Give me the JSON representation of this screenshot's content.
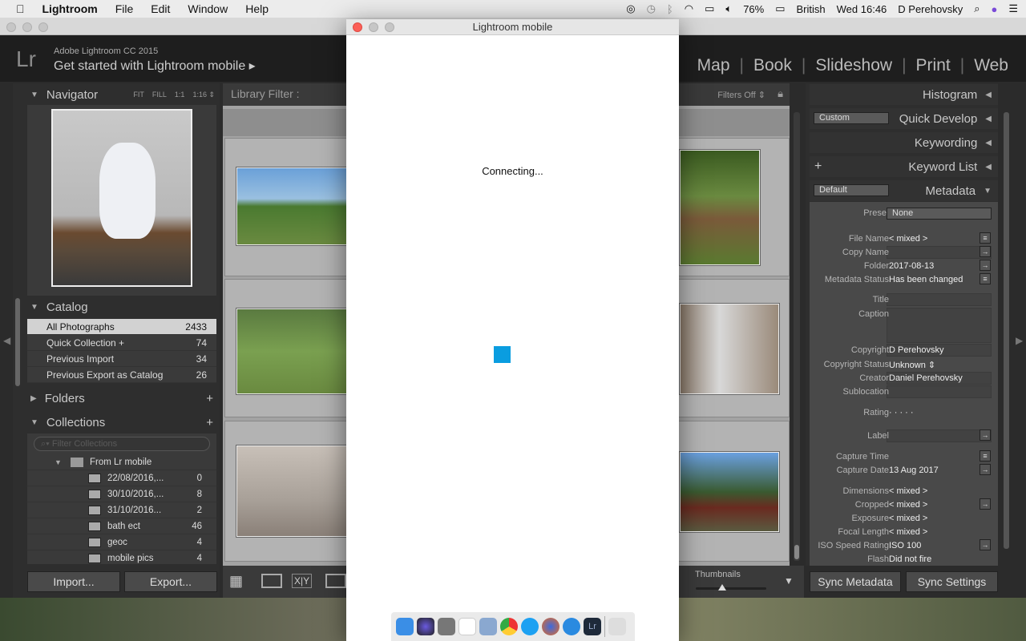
{
  "menubar": {
    "apple": "",
    "app": "Lightroom",
    "items": [
      "File",
      "Edit",
      "Window",
      "Help"
    ],
    "battery": "76%",
    "input_source": "British",
    "clock": "Wed 16:46",
    "user": "D Perehovsky"
  },
  "identity": {
    "logo": "Lr",
    "product": "Adobe Lightroom CC 2015",
    "tagline": "Get started with Lightroom mobile ▸"
  },
  "modules": [
    "Map",
    "Book",
    "Slideshow",
    "Print",
    "Web"
  ],
  "navigator": {
    "title": "Navigator",
    "zoom": [
      "FIT",
      "FILL",
      "1:1",
      "1:16 ⇕"
    ]
  },
  "catalog": {
    "title": "Catalog",
    "items": [
      {
        "label": "All Photographs",
        "count": "2433"
      },
      {
        "label": "Quick Collection +",
        "count": "74"
      },
      {
        "label": "Previous Import",
        "count": "34"
      },
      {
        "label": "Previous Export as Catalog",
        "count": "26"
      }
    ]
  },
  "folders": {
    "title": "Folders",
    "add": "+"
  },
  "collections": {
    "title": "Collections",
    "add": "+",
    "filter_placeholder": "Filter Collections",
    "set": "From Lr mobile",
    "items": [
      {
        "label": "22/08/2016,...",
        "count": "0"
      },
      {
        "label": "30/10/2016,...",
        "count": "8"
      },
      {
        "label": "31/10/2016...",
        "count": "2"
      },
      {
        "label": "bath ect",
        "count": "46"
      },
      {
        "label": "geoc",
        "count": "4"
      },
      {
        "label": "mobile pics",
        "count": "4"
      }
    ]
  },
  "left_buttons": {
    "import": "Import...",
    "export": "Export..."
  },
  "library_filter": {
    "label": "Library Filter :",
    "filters": "Filters Off ⇕"
  },
  "toolbar": {
    "thumbnails": "Thumbnails",
    "compare": "X|Y"
  },
  "right": {
    "histogram": "Histogram",
    "quick_develop": "Quick Develop",
    "qd_preset": "Custom",
    "keywording": "Keywording",
    "keyword_list": "Keyword List",
    "metadata": "Metadata",
    "meta_preset": "Default",
    "preset_label": "Preset",
    "preset_value": "None",
    "rows": [
      {
        "label": "File Name",
        "value": "< mixed >",
        "btn": "≡"
      },
      {
        "label": "Copy Name",
        "value": "",
        "box": true,
        "btn": "→"
      },
      {
        "label": "Folder",
        "value": "2017-08-13",
        "btn": "→"
      },
      {
        "label": "Metadata Status",
        "value": "Has been changed",
        "btn": "≡"
      },
      {
        "label": "Title",
        "value": "",
        "box": true
      },
      {
        "label": "Caption",
        "value": "",
        "box": true
      },
      {
        "label": "Copyright",
        "value": "D Perehovsky",
        "box": true
      },
      {
        "label": "Copyright Status",
        "value": "Unknown ⇕"
      },
      {
        "label": "Creator",
        "value": "Daniel Perehovsky",
        "box": true
      },
      {
        "label": "Sublocation",
        "value": "",
        "box": true
      },
      {
        "label": "Rating",
        "value": "·   ·   ·   ·   ·"
      },
      {
        "label": "Label",
        "value": "",
        "box": true,
        "btn": "→"
      },
      {
        "label": "Capture Time",
        "value": "",
        "btn": "≡"
      },
      {
        "label": "Capture Date",
        "value": "13 Aug 2017",
        "btn": "→"
      },
      {
        "label": "Dimensions",
        "value": "< mixed >"
      },
      {
        "label": "Cropped",
        "value": "< mixed >",
        "btn": "→"
      },
      {
        "label": "Exposure",
        "value": "< mixed >"
      },
      {
        "label": "Focal Length",
        "value": "< mixed >"
      },
      {
        "label": "ISO Speed Rating",
        "value": "ISO 100",
        "btn": "→"
      },
      {
        "label": "Flash",
        "value": "Did not fire"
      }
    ],
    "sync_metadata": "Sync Metadata",
    "sync_settings": "Sync Settings"
  },
  "modal": {
    "title": "Lightroom mobile",
    "status": "Connecting...",
    "accent": "#0a9de0"
  }
}
